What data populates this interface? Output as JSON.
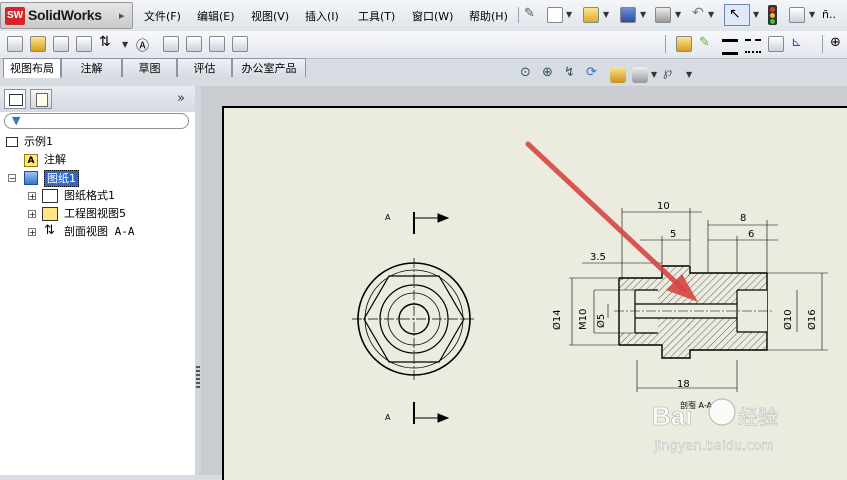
{
  "app": {
    "name": "SolidWorks",
    "logo_badge": "SW"
  },
  "menu": [
    "文件(F)",
    "编辑(E)",
    "视图(V)",
    "插入(I)",
    "工具(T)",
    "窗口(W)",
    "帮助(H)"
  ],
  "toolbar_right_overflow": "ñ..",
  "command_tabs": [
    {
      "label": "视图布局",
      "active": true
    },
    {
      "label": "注解",
      "active": false
    },
    {
      "label": "草图",
      "active": false
    },
    {
      "label": "评估",
      "active": false
    },
    {
      "label": "办公室产品",
      "active": false
    }
  ],
  "feature_tree": {
    "collapse_label": "»",
    "root": "示例1",
    "items": [
      {
        "label": "注解",
        "icon": "annotation-icon"
      },
      {
        "label": "图纸1",
        "icon": "sheet-icon",
        "selected": true
      }
    ],
    "children": [
      {
        "label": "图纸格式1",
        "icon": "sheet-format-icon"
      },
      {
        "label": "工程图视图5",
        "icon": "drawing-view-icon"
      },
      {
        "label": "剖面视图 A-A",
        "icon": "section-view-icon"
      }
    ]
  },
  "drawing": {
    "dimensions": [
      "10",
      "5",
      "8",
      "6",
      "3.5",
      "Ø14",
      "M10",
      "Ø5",
      "Ø10",
      "Ø16",
      "18"
    ],
    "section_labels": [
      "A",
      "A"
    ],
    "section_title": "剖面 A-A"
  },
  "watermark": {
    "brand": "Bai",
    "brand2": "经验",
    "url": "jingyan.baidu.com"
  },
  "colors": {
    "accent_red": "#d3252b",
    "arrow_red": "#d64541",
    "selected_highlight": "#3168c6",
    "sheet_bg": "#ebebe0"
  }
}
